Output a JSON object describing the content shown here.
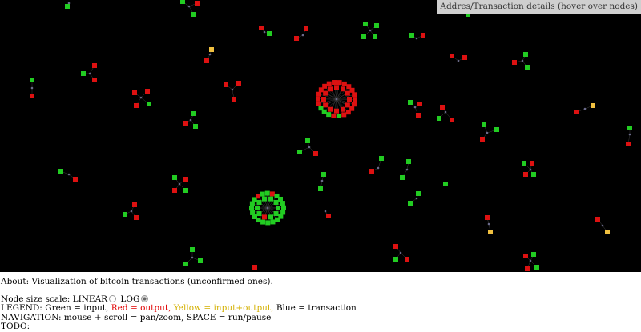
{
  "details_label": "Addres/Transaction details (hover over nodes)",
  "about": "About: Visualization of bitcoin transactions (unconfirmed ones).",
  "scale": {
    "label": "Node size scale:",
    "options": [
      {
        "label": "LINEAR",
        "selected": false
      },
      {
        "label": "LOG",
        "selected": true
      }
    ]
  },
  "legend": {
    "label": "LEGEND:",
    "green": "Green = input,",
    "red": "Red = output,",
    "yellow": "Yellow = input+output,",
    "blue": "Blue = transaction"
  },
  "navigation": "NAVIGATION: mouse + scroll = pan/zoom, SPACE = run/pause",
  "todo": "TODO:",
  "colors": {
    "background": "#000000",
    "input": "#22cc22",
    "output": "#dd1111",
    "input_output": "#f0c040",
    "transaction": "#3355cc"
  }
}
